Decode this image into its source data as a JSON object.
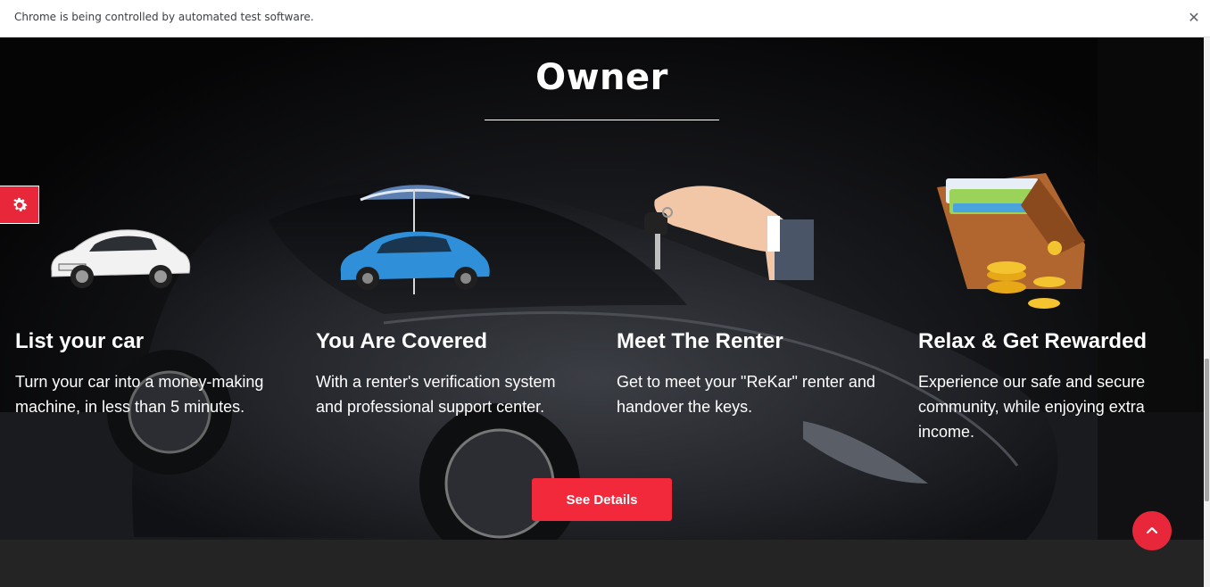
{
  "browser": {
    "infobar_text": "Chrome is being controlled by automated test software.",
    "close_icon": "close-icon"
  },
  "section": {
    "title": "Owner"
  },
  "features": [
    {
      "title": "List your car",
      "description": "Turn your car into a money-making machine, in less than 5 minutes.",
      "icon": "white-car-icon"
    },
    {
      "title": "You Are Covered",
      "description": "With a renter's verification system and professional support center.",
      "icon": "covered-car-umbrella-icon"
    },
    {
      "title": "Meet The Renter",
      "description": "Get to meet your \"ReKar\" renter and handover the keys.",
      "icon": "hand-key-icon"
    },
    {
      "title": "Relax & Get Rewarded",
      "description": "Experience our safe and secure community, while enjoying extra income.",
      "icon": "wallet-coins-icon"
    }
  ],
  "actions": {
    "see_details_label": "See Details"
  },
  "colors": {
    "accent": "#f2283b",
    "background": "#0a0a0b",
    "footer": "#242424",
    "text": "#ffffff"
  }
}
